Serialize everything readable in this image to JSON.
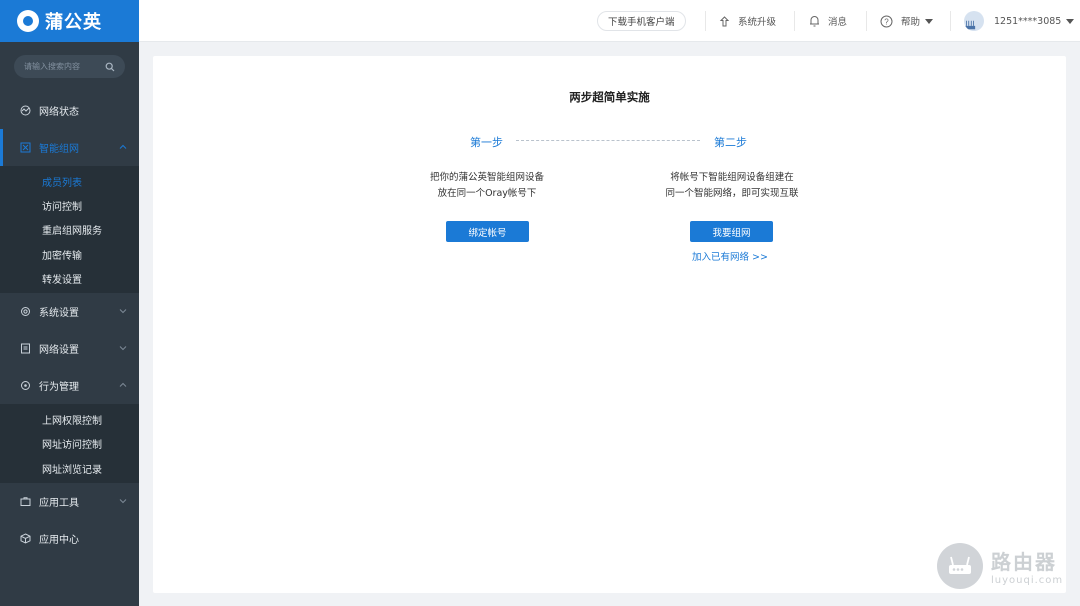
{
  "brand": {
    "name": "蒲公英"
  },
  "search": {
    "placeholder": "请输入搜索内容"
  },
  "sidebar": {
    "items": [
      {
        "label": "网络状态"
      },
      {
        "label": "智能组网",
        "submenu": [
          "成员列表",
          "访问控制",
          "重启组网服务",
          "加密传输",
          "转发设置"
        ]
      },
      {
        "label": "系统设置"
      },
      {
        "label": "网络设置"
      },
      {
        "label": "行为管理",
        "submenu": [
          "上网权限控制",
          "网址访问控制",
          "网址浏览记录"
        ]
      },
      {
        "label": "应用工具"
      },
      {
        "label": "应用中心"
      }
    ]
  },
  "topbar": {
    "download_label": "下载手机客户端",
    "upgrade_label": "系统升级",
    "messages_label": "消息",
    "help_label": "帮助",
    "user_label": "1251****3085"
  },
  "main": {
    "title": "两步超简单实施",
    "step1": {
      "title": "第一步",
      "desc_line1": "把你的蒲公英智能组网设备",
      "desc_line2": "放在同一个Oray帐号下",
      "button_label": "绑定帐号"
    },
    "step2": {
      "title": "第二步",
      "desc_line1": "将帐号下智能组网设备组建在",
      "desc_line2": "同一个智能网络，即可实现互联",
      "button_label": "我要组网",
      "link_label": "加入已有网络 >>"
    }
  },
  "watermark": {
    "name": "路由器",
    "domain": "luyouqi.com"
  },
  "colors": {
    "accent": "#1b7ad6",
    "sidebar_bg": "#303b45",
    "submenu_bg": "#263038"
  }
}
